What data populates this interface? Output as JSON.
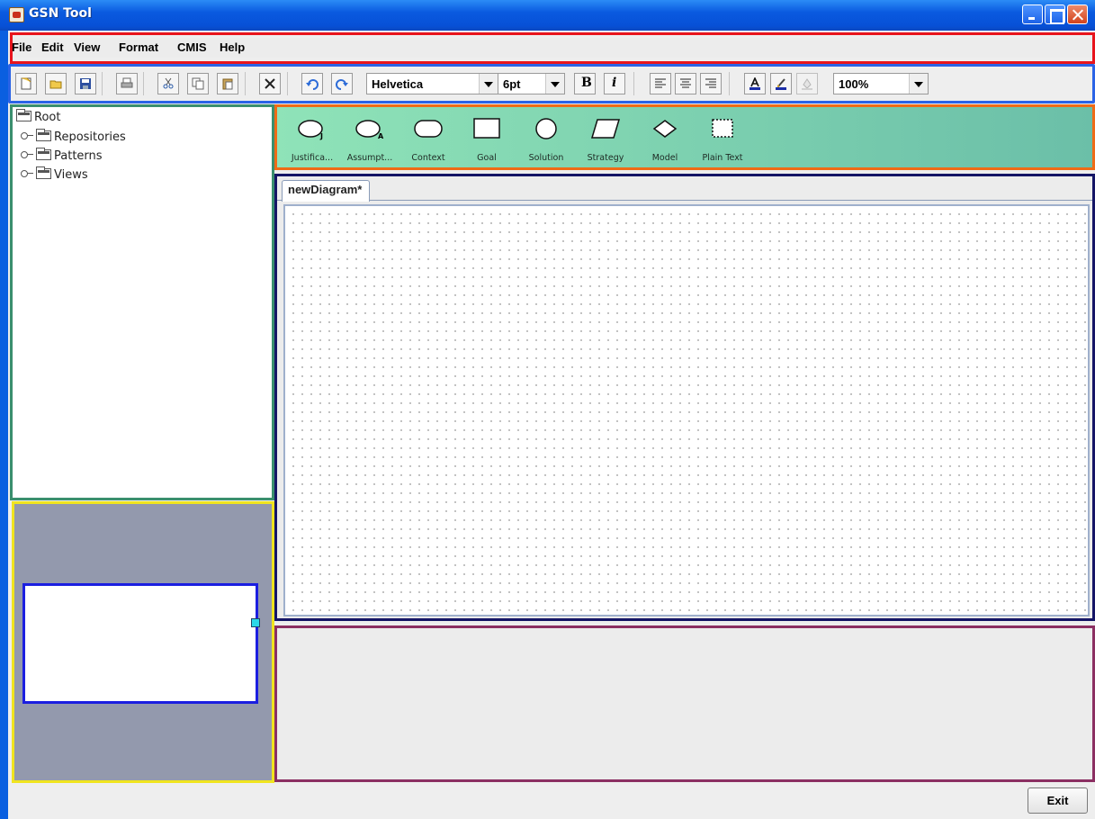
{
  "window": {
    "title": "GSN Tool"
  },
  "menu": [
    "File",
    "Edit",
    "View",
    "Format",
    "CMIS",
    "Help"
  ],
  "toolbar": {
    "font_family": "Helvetica",
    "font_size": "6pt",
    "bold_label": "B",
    "italic_label": "i",
    "zoom": "100%",
    "icons": [
      "new-icon",
      "open-icon",
      "save-icon",
      "print-icon",
      "cut-icon",
      "copy-icon",
      "paste-icon",
      "delete-icon",
      "undo-icon",
      "redo-icon",
      "bold-icon",
      "italic-icon",
      "align-left-icon",
      "align-center-icon",
      "align-right-icon",
      "font-color-icon",
      "fill-color-icon",
      "line-color-icon"
    ]
  },
  "tree": {
    "root": "Root",
    "children": [
      "Repositories",
      "Patterns",
      "Views"
    ]
  },
  "palette": {
    "items": [
      {
        "label": "Justifica...",
        "icon": "justification-icon"
      },
      {
        "label": "Assumpt...",
        "icon": "assumption-icon"
      },
      {
        "label": "Context",
        "icon": "context-icon"
      },
      {
        "label": "Goal",
        "icon": "goal-icon"
      },
      {
        "label": "Solution",
        "icon": "solution-icon"
      },
      {
        "label": "Strategy",
        "icon": "strategy-icon"
      },
      {
        "label": "Model",
        "icon": "model-icon"
      },
      {
        "label": "Plain Text",
        "icon": "plain-text-icon"
      }
    ]
  },
  "diagram": {
    "tab_label": "newDiagram*"
  },
  "footer": {
    "exit_label": "Exit"
  }
}
